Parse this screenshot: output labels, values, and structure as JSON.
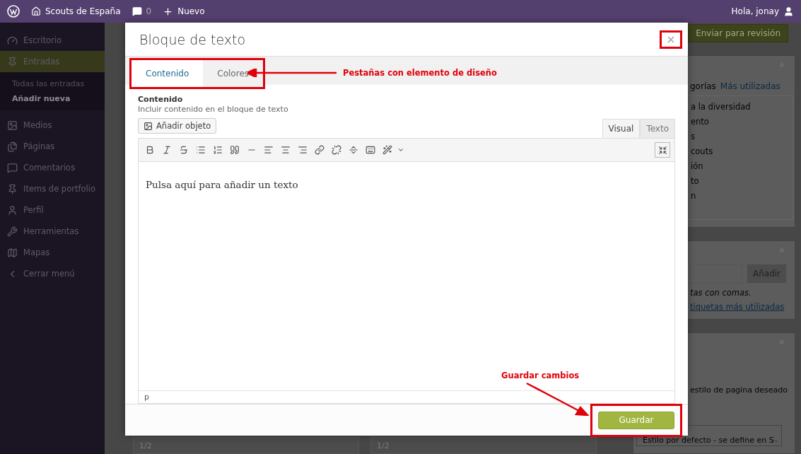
{
  "admin_bar": {
    "site": "Scouts de España",
    "comments": "0",
    "new": "Nuevo",
    "greeting": "Hola, jonay"
  },
  "sidebar": {
    "items": [
      {
        "label": "Escritorio",
        "kind": "gauge",
        "selected": false
      },
      {
        "label": "Entradas",
        "kind": "pin",
        "selected": true,
        "children": [
          {
            "label": "Todas las entradas",
            "selected": false
          },
          {
            "label": "Añadir nueva",
            "selected": true
          }
        ]
      },
      {
        "label": "Medios",
        "kind": "media",
        "selected": false
      },
      {
        "label": "Páginas",
        "kind": "pages",
        "selected": false
      },
      {
        "label": "Comentarios",
        "kind": "comment",
        "selected": false
      },
      {
        "label": "Items de portfolio",
        "kind": "pin",
        "selected": false
      },
      {
        "label": "Perfil",
        "kind": "user",
        "selected": false
      },
      {
        "label": "Herramientas",
        "kind": "wrench",
        "selected": false
      },
      {
        "label": "Mapas",
        "kind": "map",
        "selected": false
      },
      {
        "label": "Cerrar menú",
        "kind": "collapse",
        "selected": false
      }
    ]
  },
  "background": {
    "submit": "Enviar para revisión",
    "categories": {
      "tabs": [
        {
          "label": "gorías",
          "selected": true
        },
        {
          "label": "Más utilizadas",
          "selected": false
        }
      ],
      "items": [
        "a la diversidad",
        "ento",
        "s",
        "couts",
        "ión",
        "to",
        "n"
      ]
    },
    "tags": {
      "button": "Añadir",
      "hint": "tas con comas.",
      "link": "tiquetas más utilizadas"
    },
    "style": {
      "label": "estilo de pagina deseado",
      "select": "Estilo por defecto - se define en S"
    },
    "fields": [
      "1/2",
      "1/2"
    ]
  },
  "modal": {
    "title": "Bloque de texto",
    "tabs": [
      {
        "label": "Contenido",
        "selected": true
      },
      {
        "label": "Colores",
        "selected": false
      }
    ],
    "field_label": "Contenido",
    "field_hint": "Incluir contenido en el bloque de texto",
    "add_media": "Añadir objeto",
    "editor_tabs": [
      {
        "label": "Visual",
        "selected": true
      },
      {
        "label": "Texto",
        "selected": false
      }
    ],
    "toolbar": [
      {
        "kind": "bold"
      },
      {
        "kind": "italic"
      },
      {
        "kind": "strike"
      },
      {
        "kind": "bullets"
      },
      {
        "kind": "numbers"
      },
      {
        "kind": "quote"
      },
      {
        "kind": "rule"
      },
      {
        "kind": "align-left"
      },
      {
        "kind": "align-center"
      },
      {
        "kind": "align-right"
      },
      {
        "kind": "link"
      },
      {
        "kind": "unlink"
      },
      {
        "kind": "more"
      },
      {
        "kind": "keyboard"
      },
      {
        "kind": "wand"
      }
    ],
    "editor_text": "Pulsa aquí para añadir un texto",
    "status_path": "p",
    "save": "Guardar"
  },
  "annotations": {
    "tabs": "Pestañas con elemento de diseño",
    "save": "Guardar cambios"
  }
}
